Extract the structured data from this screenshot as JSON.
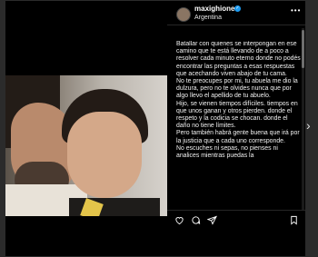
{
  "post": {
    "username": "maxighione",
    "location": "Argentina",
    "caption": [
      "Batallar con quienes se interpongan en ese camino que te está  llevando de a poco a resolver cada minuto eterno donde no podés encontrar las preguntas  a esas respuestas que acechando viven abajo de tu cama.",
      "No te preocupes por mi, tu abuela me dio la dulzura, pero no te olvides nunca que por algo llevo el apellido de tu abuelo.",
      "Hijo, se vienen tiempos difíciles. tiempos en que unos ganan y otros pierden. donde el respeto y la codicia se chocan. donde el daño no tiene límites.",
      "Pero también habrá gente buena que irá por la justicia que a cada uno corresponde.",
      "No escuches ni sepas, no pienses ni analices mientras puedas la"
    ]
  },
  "icons": {
    "verified": "verified-badge-icon",
    "more": "more-options-icon",
    "like": "heart-icon",
    "comment": "comment-icon",
    "share": "share-icon",
    "save": "bookmark-icon",
    "next": "chevron-right-icon"
  },
  "colors": {
    "background": "#000000",
    "verified": "#1d9bf0",
    "page": "#2b2b2b"
  }
}
